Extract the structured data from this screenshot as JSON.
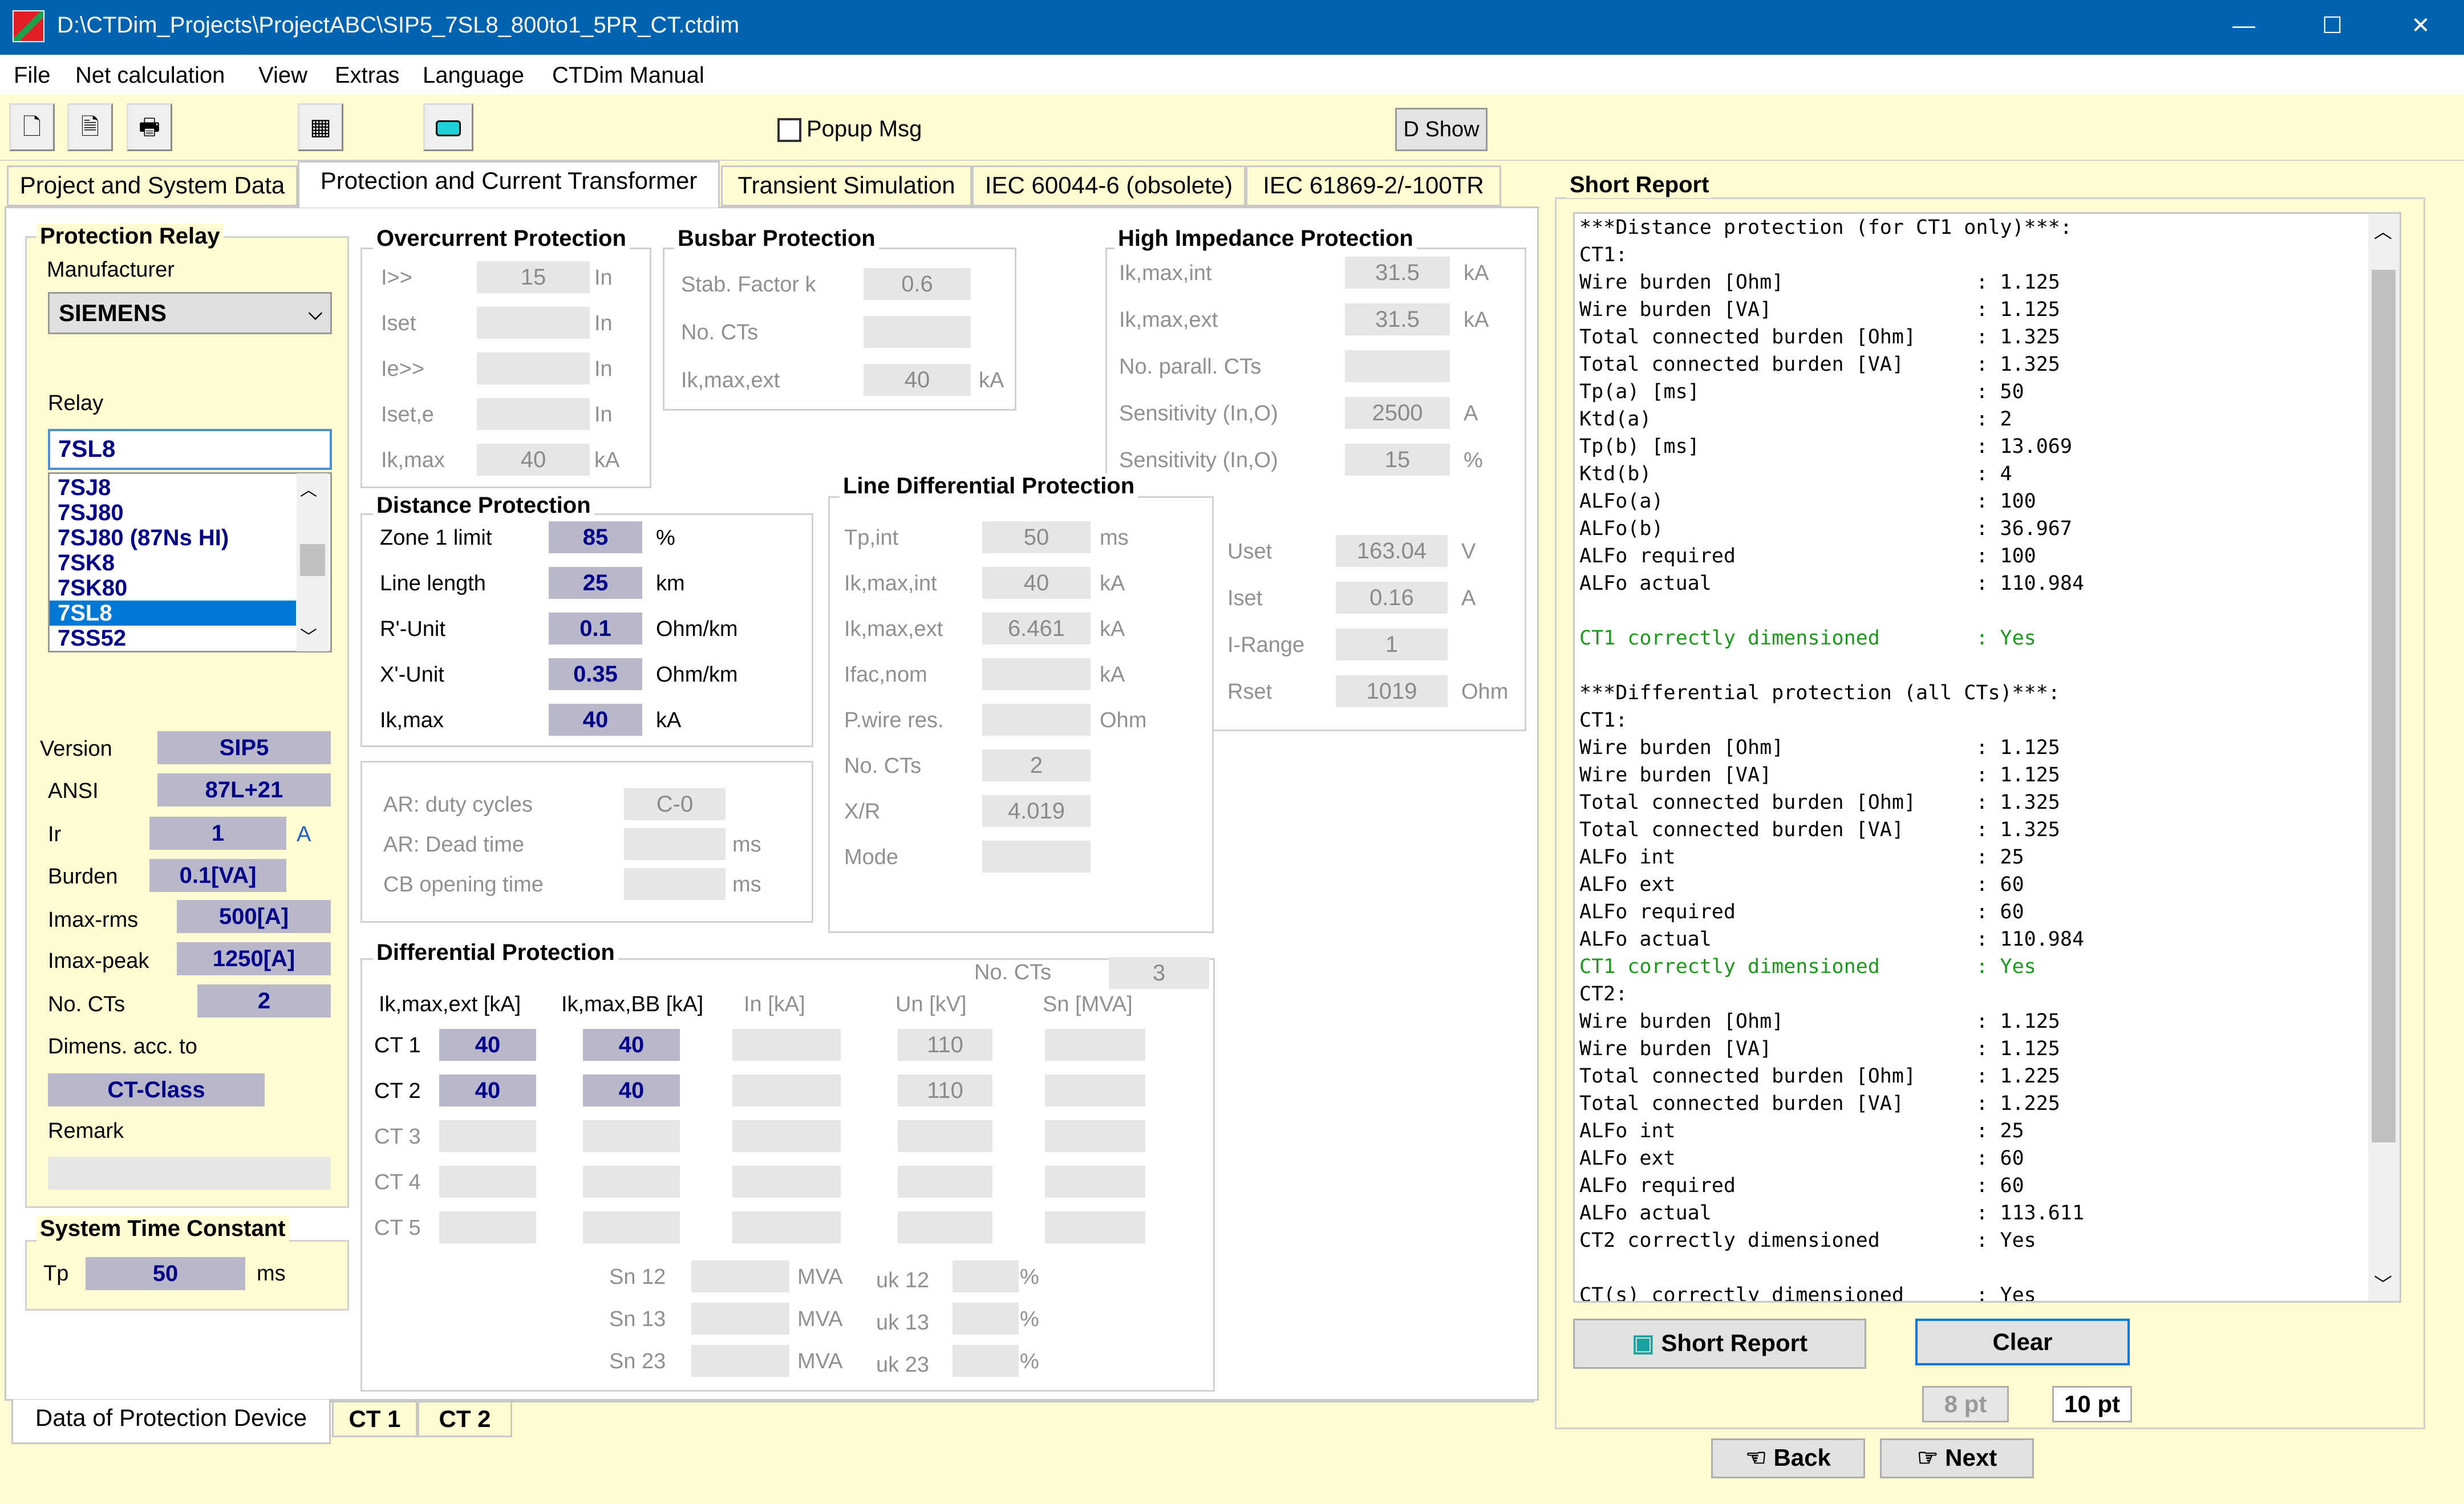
{
  "window": {
    "title": "D:\\CTDim_Projects\\ProjectABC\\SIP5_7SL8_800to1_5PR_CT.ctdim",
    "minimize": "—",
    "maximize": "☐",
    "close": "✕"
  },
  "menu": [
    "File",
    "Net calculation",
    "View",
    "Extras",
    "Language",
    "CTDim Manual"
  ],
  "toolbar": {
    "popup_label": "Popup Msg",
    "dshow_label": "D Show",
    "icons": [
      "new-file-icon",
      "document-icon",
      "print-icon",
      "calculator-icon",
      "screen-icon"
    ]
  },
  "tabs": [
    "Project and System Data",
    "Protection and Current Transformer",
    "Transient Simulation",
    "IEC 60044-6 (obsolete)",
    "IEC 61869-2/-100TR"
  ],
  "protection_relay": {
    "title": "Protection Relay",
    "manufacturer_label": "Manufacturer",
    "manufacturer": "SIEMENS",
    "relay_label": "Relay",
    "relay": "7SL8",
    "relay_list": [
      "7SJ8",
      "7SJ80",
      "7SJ80 (87Ns HI)",
      "7SK8",
      "7SK80",
      "7SL8",
      "7SS52"
    ],
    "version_label": "Version",
    "version": "SIP5",
    "ansi_label": "ANSI",
    "ansi": "87L+21",
    "ir_label": "Ir",
    "ir": "1",
    "ir_unit": "A",
    "burden_label": "Burden",
    "burden": "0.1[VA]",
    "imax_rms_label": "Imax-rms",
    "imax_rms": "500[A]",
    "imax_peak_label": "Imax-peak",
    "imax_peak": "1250[A]",
    "no_cts_label": "No. CTs",
    "no_cts": "2",
    "dimens_label": "Dimens. acc. to",
    "dimens": "CT-Class",
    "remark_label": "Remark",
    "remark": ""
  },
  "system_time": {
    "title": "System Time Constant",
    "tp_label": "Tp",
    "tp": "50",
    "tp_unit": "ms"
  },
  "overcurrent": {
    "title": "Overcurrent Protection",
    "rows": [
      {
        "label": "I>>",
        "value": "15",
        "unit": "In"
      },
      {
        "label": "Iset",
        "value": "",
        "unit": "In"
      },
      {
        "label": "Ie>>",
        "value": "",
        "unit": "In"
      },
      {
        "label": "Iset,e",
        "value": "",
        "unit": "In"
      },
      {
        "label": "Ik,max",
        "value": "40",
        "unit": "kA"
      }
    ]
  },
  "busbar": {
    "title": "Busbar Protection",
    "rows": [
      {
        "label": "Stab. Factor k",
        "value": "0.6",
        "unit": ""
      },
      {
        "label": "No. CTs",
        "value": "",
        "unit": ""
      },
      {
        "label": "Ik,max,ext",
        "value": "40",
        "unit": "kA"
      }
    ]
  },
  "high_impedance": {
    "title": "High Impedance Protection",
    "rows": [
      {
        "label": "Ik,max,int",
        "value": "31.5",
        "unit": "kA"
      },
      {
        "label": "Ik,max,ext",
        "value": "31.5",
        "unit": "kA"
      },
      {
        "label": "No. parall. CTs",
        "value": "",
        "unit": ""
      },
      {
        "label": "Sensitivity (In,O)",
        "value": "2500",
        "unit": "A"
      },
      {
        "label": "Sensitivity (In,O)",
        "value": "15",
        "unit": "%"
      }
    ],
    "rows2": [
      {
        "label": "Uset",
        "value": "163.04",
        "unit": "V"
      },
      {
        "label": "Iset",
        "value": "0.16",
        "unit": "A"
      },
      {
        "label": "I-Range",
        "value": "1",
        "unit": ""
      },
      {
        "label": "Rset",
        "value": "1019",
        "unit": "Ohm"
      }
    ]
  },
  "distance": {
    "title": "Distance Protection",
    "rows": [
      {
        "label": "Zone 1 limit",
        "value": "85",
        "unit": "%"
      },
      {
        "label": "Line length",
        "value": "25",
        "unit": "km"
      },
      {
        "label": "R'-Unit",
        "value": "0.1",
        "unit": "Ohm/km"
      },
      {
        "label": "X'-Unit",
        "value": "0.35",
        "unit": "Ohm/km"
      },
      {
        "label": "Ik,max",
        "value": "40",
        "unit": "kA"
      }
    ]
  },
  "autoreclose": {
    "rows": [
      {
        "label": "AR: duty cycles",
        "value": "C-0",
        "unit": ""
      },
      {
        "label": "AR: Dead time",
        "value": "",
        "unit": "ms"
      },
      {
        "label": "CB opening time",
        "value": "",
        "unit": "ms"
      }
    ]
  },
  "line_diff": {
    "title": "Line Differential Protection",
    "rows": [
      {
        "label": "Tp,int",
        "value": "50",
        "unit": "ms"
      },
      {
        "label": "Ik,max,int",
        "value": "40",
        "unit": "kA"
      },
      {
        "label": "Ik,max,ext",
        "value": "6.461",
        "unit": "kA"
      },
      {
        "label": "Ifac,nom",
        "value": "",
        "unit": "kA"
      },
      {
        "label": "P.wire res.",
        "value": "",
        "unit": "Ohm"
      },
      {
        "label": "No. CTs",
        "value": "2",
        "unit": ""
      },
      {
        "label": "X/R",
        "value": "4.019",
        "unit": ""
      },
      {
        "label": "Mode",
        "value": "",
        "unit": ""
      }
    ]
  },
  "differential": {
    "title": "Differential Protection",
    "no_cts_label": "No. CTs",
    "no_cts": "3",
    "headers": [
      "Ik,max,ext [kA]",
      "Ik,max,BB [kA]",
      "In [kA]",
      "Un [kV]",
      "Sn [MVA]"
    ],
    "rows": [
      {
        "label": "CT 1",
        "v": [
          "40",
          "40",
          "",
          "110",
          ""
        ]
      },
      {
        "label": "CT 2",
        "v": [
          "40",
          "40",
          "",
          "110",
          ""
        ]
      },
      {
        "label": "CT 3",
        "v": [
          "",
          "",
          "",
          "",
          ""
        ]
      },
      {
        "label": "CT 4",
        "v": [
          "",
          "",
          "",
          "",
          ""
        ]
      },
      {
        "label": "CT 5",
        "v": [
          "",
          "",
          "",
          "",
          ""
        ]
      }
    ],
    "sn": [
      {
        "label": "Sn 12",
        "unit": "MVA",
        "uk": "uk 12"
      },
      {
        "label": "Sn 13",
        "unit": "MVA",
        "uk": "uk 13"
      },
      {
        "label": "Sn 23",
        "unit": "MVA",
        "uk": "uk 23"
      }
    ],
    "uk_unit": "%"
  },
  "bottom_tabs": [
    "Data of Protection Device",
    "CT 1",
    "CT 2"
  ],
  "report": {
    "title": "Short Report",
    "lines": [
      "***Distance protection (for CT1 only)***:",
      "CT1:",
      "Wire burden [Ohm]                : 1.125",
      "Wire burden [VA]                 : 1.125",
      "Total connected burden [Ohm]     : 1.325",
      "Total connected burden [VA]      : 1.325",
      "Tp(a) [ms]                       : 50",
      "Ktd(a)                           : 2",
      "Tp(b) [ms]                       : 13.069",
      "Ktd(b)                           : 4",
      "ALFo(a)                          : 100",
      "ALFo(b)                          : 36.967",
      "ALFo required                    : 100",
      "ALFo actual                      : 110.984",
      "",
      "CT1 correctly dimensioned        : Yes",
      "",
      "***Differential protection (all CTs)***:",
      "CT1:",
      "Wire burden [Ohm]                : 1.125",
      "Wire burden [VA]                 : 1.125",
      "Total connected burden [Ohm]     : 1.325",
      "Total connected burden [VA]      : 1.325",
      "ALFo int                         : 25",
      "ALFo ext                         : 60",
      "ALFo required                    : 60",
      "ALFo actual                      : 110.984",
      "CT1 correctly dimensioned        : Yes",
      "CT2:",
      "Wire burden [Ohm]                : 1.125",
      "Wire burden [VA]                 : 1.125",
      "Total connected burden [Ohm]     : 1.225",
      "Total connected burden [VA]      : 1.225",
      "ALFo int                         : 25",
      "ALFo ext                         : 60",
      "ALFo required                    : 60",
      "ALFo actual                      : 113.611",
      "CT2 correctly dimensioned        : Yes",
      "",
      "CT(s) correctly dimensioned      : Yes"
    ],
    "ok_lines": [
      15,
      27,
      38,
      40
    ],
    "short_report_btn": "Short Report",
    "clear_btn": "Clear",
    "pt8": "8 pt",
    "pt10": "10 pt",
    "back": "Back",
    "next": "Next"
  }
}
